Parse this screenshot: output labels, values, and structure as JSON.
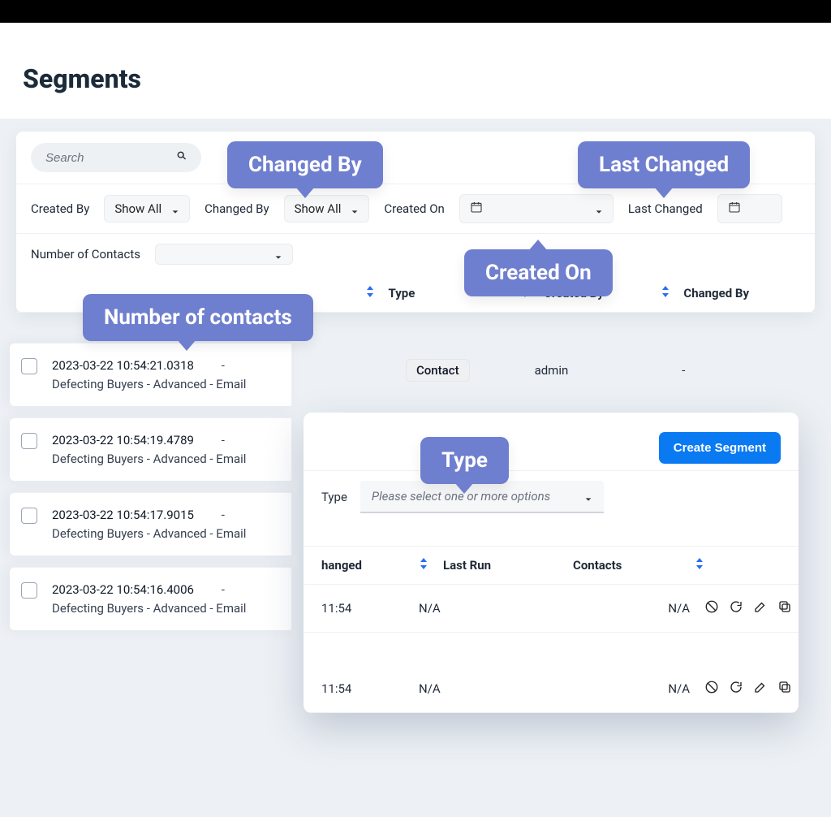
{
  "page": {
    "title": "Segments"
  },
  "search": {
    "placeholder": "Search"
  },
  "filters": {
    "created_by": {
      "label": "Created By",
      "value": "Show All"
    },
    "changed_by": {
      "label": "Changed By",
      "value": "Show All"
    },
    "created_on": {
      "label": "Created On"
    },
    "last_changed": {
      "label": "Last Changed"
    },
    "num_contacts": {
      "label": "Number of Contacts"
    }
  },
  "columns": {
    "type": "Type",
    "created_by": "Created By",
    "changed_by": "Changed By"
  },
  "rows": [
    {
      "timestamp": "2023-03-22 10:54:21.0318",
      "name": "Defecting Buyers - Advanced - Email",
      "type": "Contact",
      "created_by": "admin",
      "changed_by": "-"
    },
    {
      "timestamp": "2023-03-22 10:54:19.4789",
      "name": "Defecting Buyers - Advanced - Email"
    },
    {
      "timestamp": "2023-03-22 10:54:17.9015",
      "name": "Defecting Buyers - Advanced - Email"
    },
    {
      "timestamp": "2023-03-22 10:54:16.4006",
      "name": "Defecting Buyers - Advanced - Email"
    }
  ],
  "float": {
    "create_btn": "Create Segment",
    "type_label": "Type",
    "type_placeholder": "Please select one or more options",
    "columns": {
      "changed": "hanged",
      "last_run": "Last Run",
      "contacts": "Contacts"
    },
    "rows": [
      {
        "changed": "11:54",
        "last_run": "N/A",
        "contacts": "N/A"
      },
      {
        "changed": "11:54",
        "last_run": "N/A",
        "contacts": "N/A"
      }
    ]
  },
  "callouts": {
    "changed_by": "Changed By",
    "last_changed": "Last Changed",
    "created_on": "Created On",
    "number_of_contacts": "Number of contacts",
    "type": "Type"
  },
  "misc": {
    "dash": "-"
  }
}
